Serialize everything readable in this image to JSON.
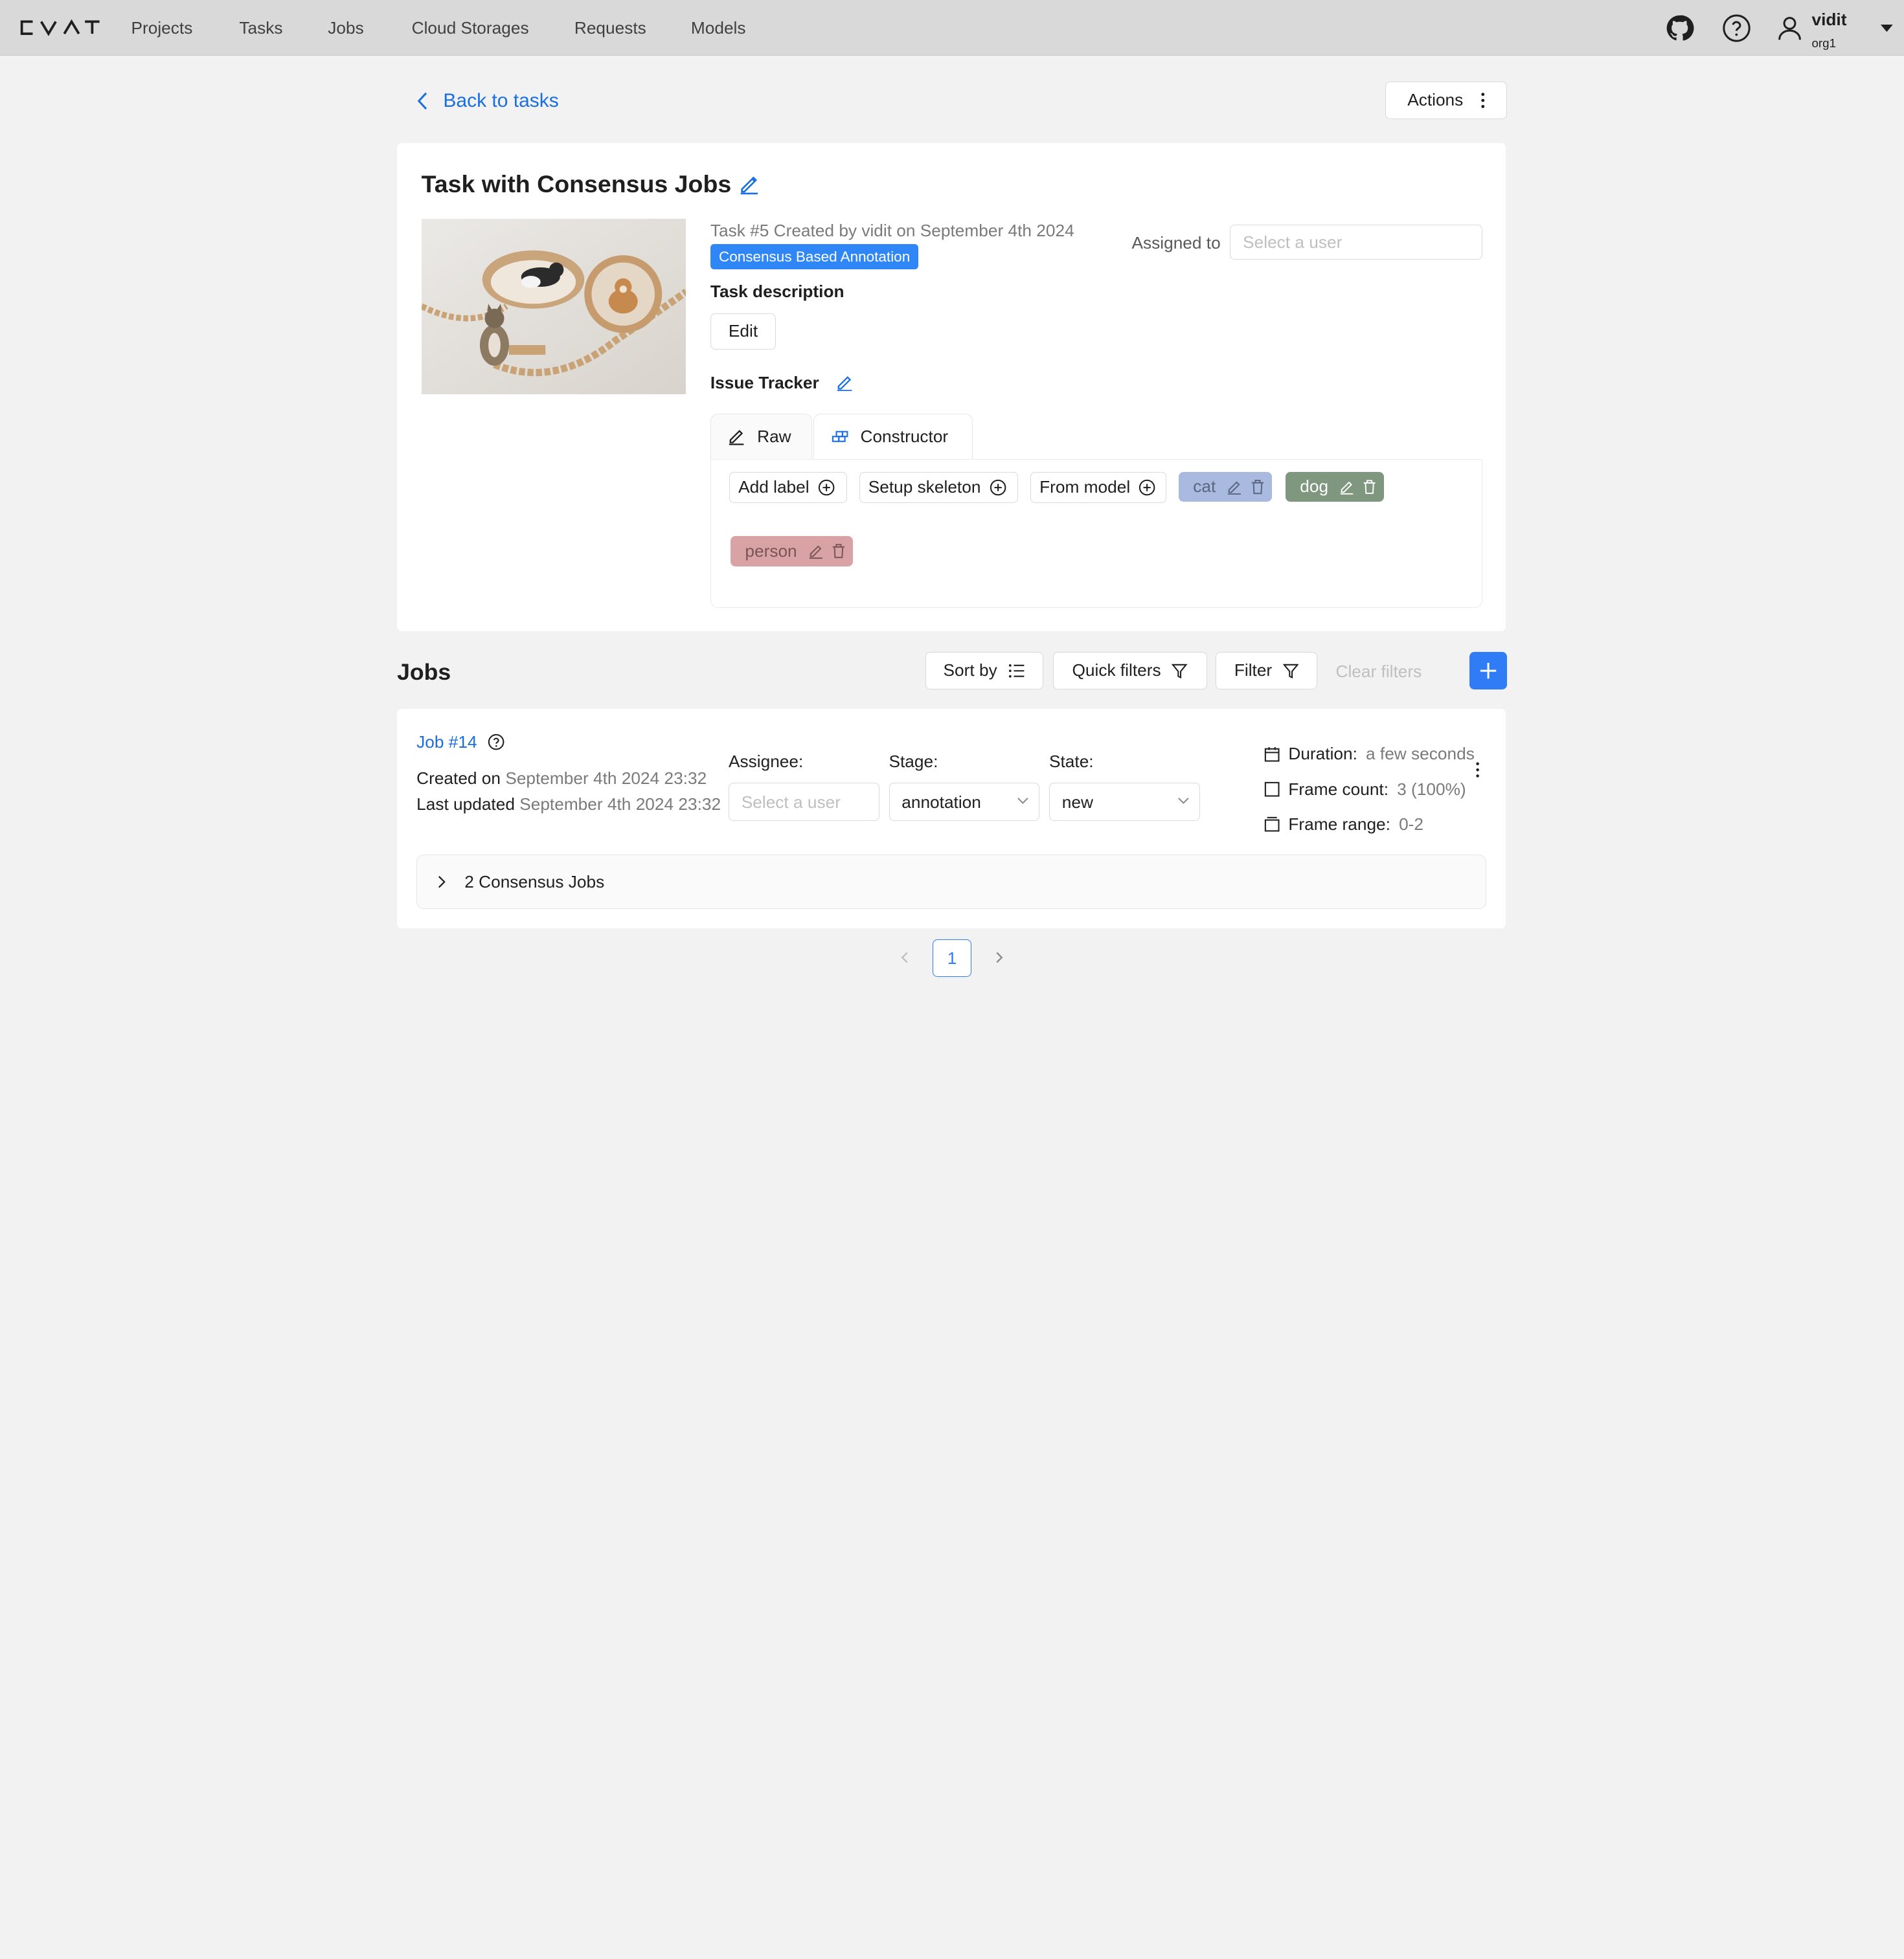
{
  "header": {
    "nav": [
      "Projects",
      "Tasks",
      "Jobs",
      "Cloud Storages",
      "Requests",
      "Models"
    ],
    "user_name": "vidit",
    "user_org": "org1",
    "icons": [
      "github-icon",
      "help-icon",
      "user-icon"
    ]
  },
  "top": {
    "back_label": "Back to tasks",
    "actions_label": "Actions"
  },
  "task": {
    "title": "Task with Consensus Jobs",
    "meta": "Task #5 Created by vidit on September 4th 2024",
    "tag": "Consensus Based Annotation",
    "tag_color": "#2f86f6",
    "assigned_label": "Assigned to",
    "assigned_placeholder": "Select a user",
    "description_label": "Task description",
    "edit_label": "Edit",
    "issue_tracker_label": "Issue Tracker",
    "tabs": [
      {
        "label": "Raw",
        "icon": "pencil-icon"
      },
      {
        "label": "Constructor",
        "icon": "constructor-icon"
      }
    ],
    "label_buttons": [
      "Add label",
      "Setup skeleton",
      "From model"
    ],
    "labels": [
      {
        "name": "cat",
        "color": "#a9b9e0"
      },
      {
        "name": "dog",
        "color": "#7f977f"
      },
      {
        "name": "person",
        "color": "#d9a3a6"
      }
    ]
  },
  "jobs": {
    "title": "Jobs",
    "sort_label": "Sort by",
    "quick_filters_label": "Quick filters",
    "filter_label": "Filter",
    "clear_filters_label": "Clear filters",
    "items": [
      {
        "name": "Job #14",
        "created_prefix": "Created on",
        "created": "September 4th 2024 23:32",
        "updated_prefix": "Last updated",
        "updated": "September 4th 2024 23:32",
        "assignee_label": "Assignee:",
        "assignee_placeholder": "Select a user",
        "stage_label": "Stage:",
        "stage": "annotation",
        "state_label": "State:",
        "state": "new",
        "duration_label": "Duration:",
        "duration": "a few seconds",
        "frame_count_label": "Frame count:",
        "frame_count": "3 (100%)",
        "frame_range_label": "Frame range:",
        "frame_range": "0-2",
        "consensus_label": "2 Consensus Jobs"
      }
    ]
  },
  "pagination": {
    "current_page": "1"
  },
  "accent_color": "#2f7cf6",
  "link_color": "#1a6fe0"
}
